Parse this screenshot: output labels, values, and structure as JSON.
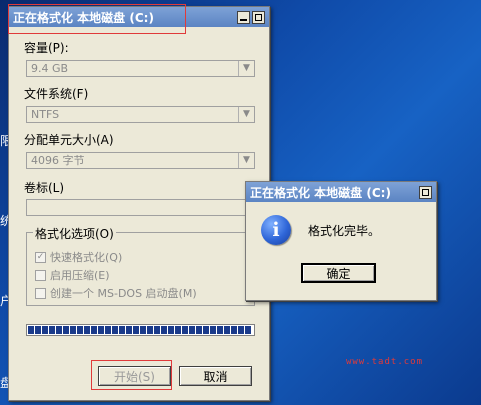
{
  "desktop_fragments": [
    "限",
    "统",
    "户",
    "盘"
  ],
  "watermark": "www.tadt.com",
  "format_window": {
    "title": "正在格式化 本地磁盘 (C:)",
    "capacity_label": "容量(P):",
    "capacity_value": "9.4 GB",
    "filesystem_label": "文件系统(F)",
    "filesystem_value": "NTFS",
    "alloc_label": "分配单元大小(A)",
    "alloc_value": "4096 字节",
    "volume_label": "卷标(L)",
    "volume_value": "",
    "options_title": "格式化选项(O)",
    "options": [
      {
        "label": "快速格式化(Q)",
        "checked": true
      },
      {
        "label": "启用压缩(E)",
        "checked": false
      },
      {
        "label": "创建一个 MS-DOS 启动盘(M)",
        "checked": false
      }
    ],
    "progress_percent": 100,
    "start_button": "开始(S)",
    "cancel_button": "取消"
  },
  "message_box": {
    "title": "正在格式化 本地磁盘 (C:)",
    "message": "格式化完毕。",
    "ok_button": "确定",
    "icon": "info-icon"
  },
  "colors": {
    "titlebar": "#6b93cd",
    "highlight": "#e03a3a",
    "progress": "#1a3a8a"
  }
}
